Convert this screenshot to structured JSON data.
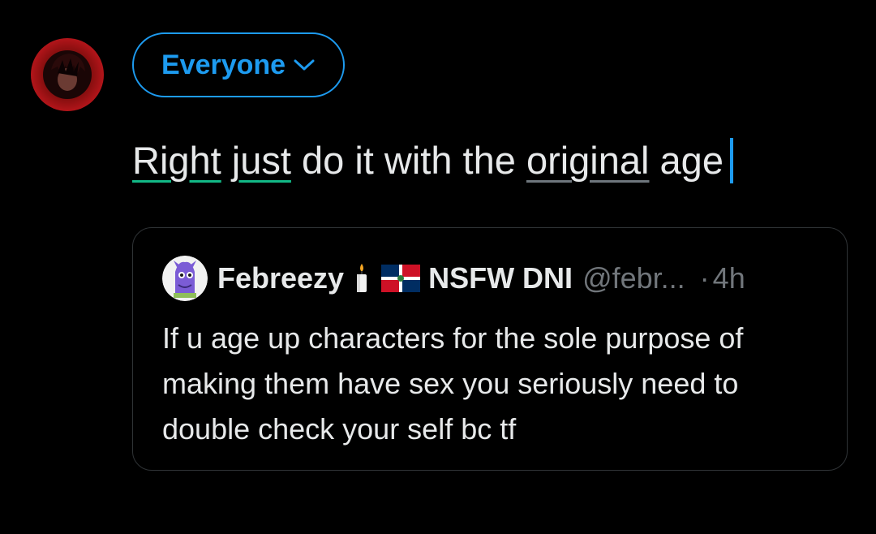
{
  "composer": {
    "audience_label": "Everyone",
    "text_words": [
      "Right",
      "just",
      "do it with the",
      "original",
      "age"
    ]
  },
  "quote": {
    "display_name": "Febreezy",
    "name_label": "NSFW DNI",
    "handle": "@febr...",
    "dot": "·",
    "time": "4h",
    "body": "If u age up characters for the sole purpose of making them have sex you seriously need to double check your self bc tf"
  },
  "icons": [
    "chevron-down-icon",
    "candle-icon",
    "dominican-flag-icon"
  ],
  "colors": {
    "background": "#000000",
    "accent": "#1d9bf0",
    "text": "#e7e9ea",
    "muted": "#71767b",
    "border": "#2f3336",
    "spell_green": "#12b886"
  }
}
